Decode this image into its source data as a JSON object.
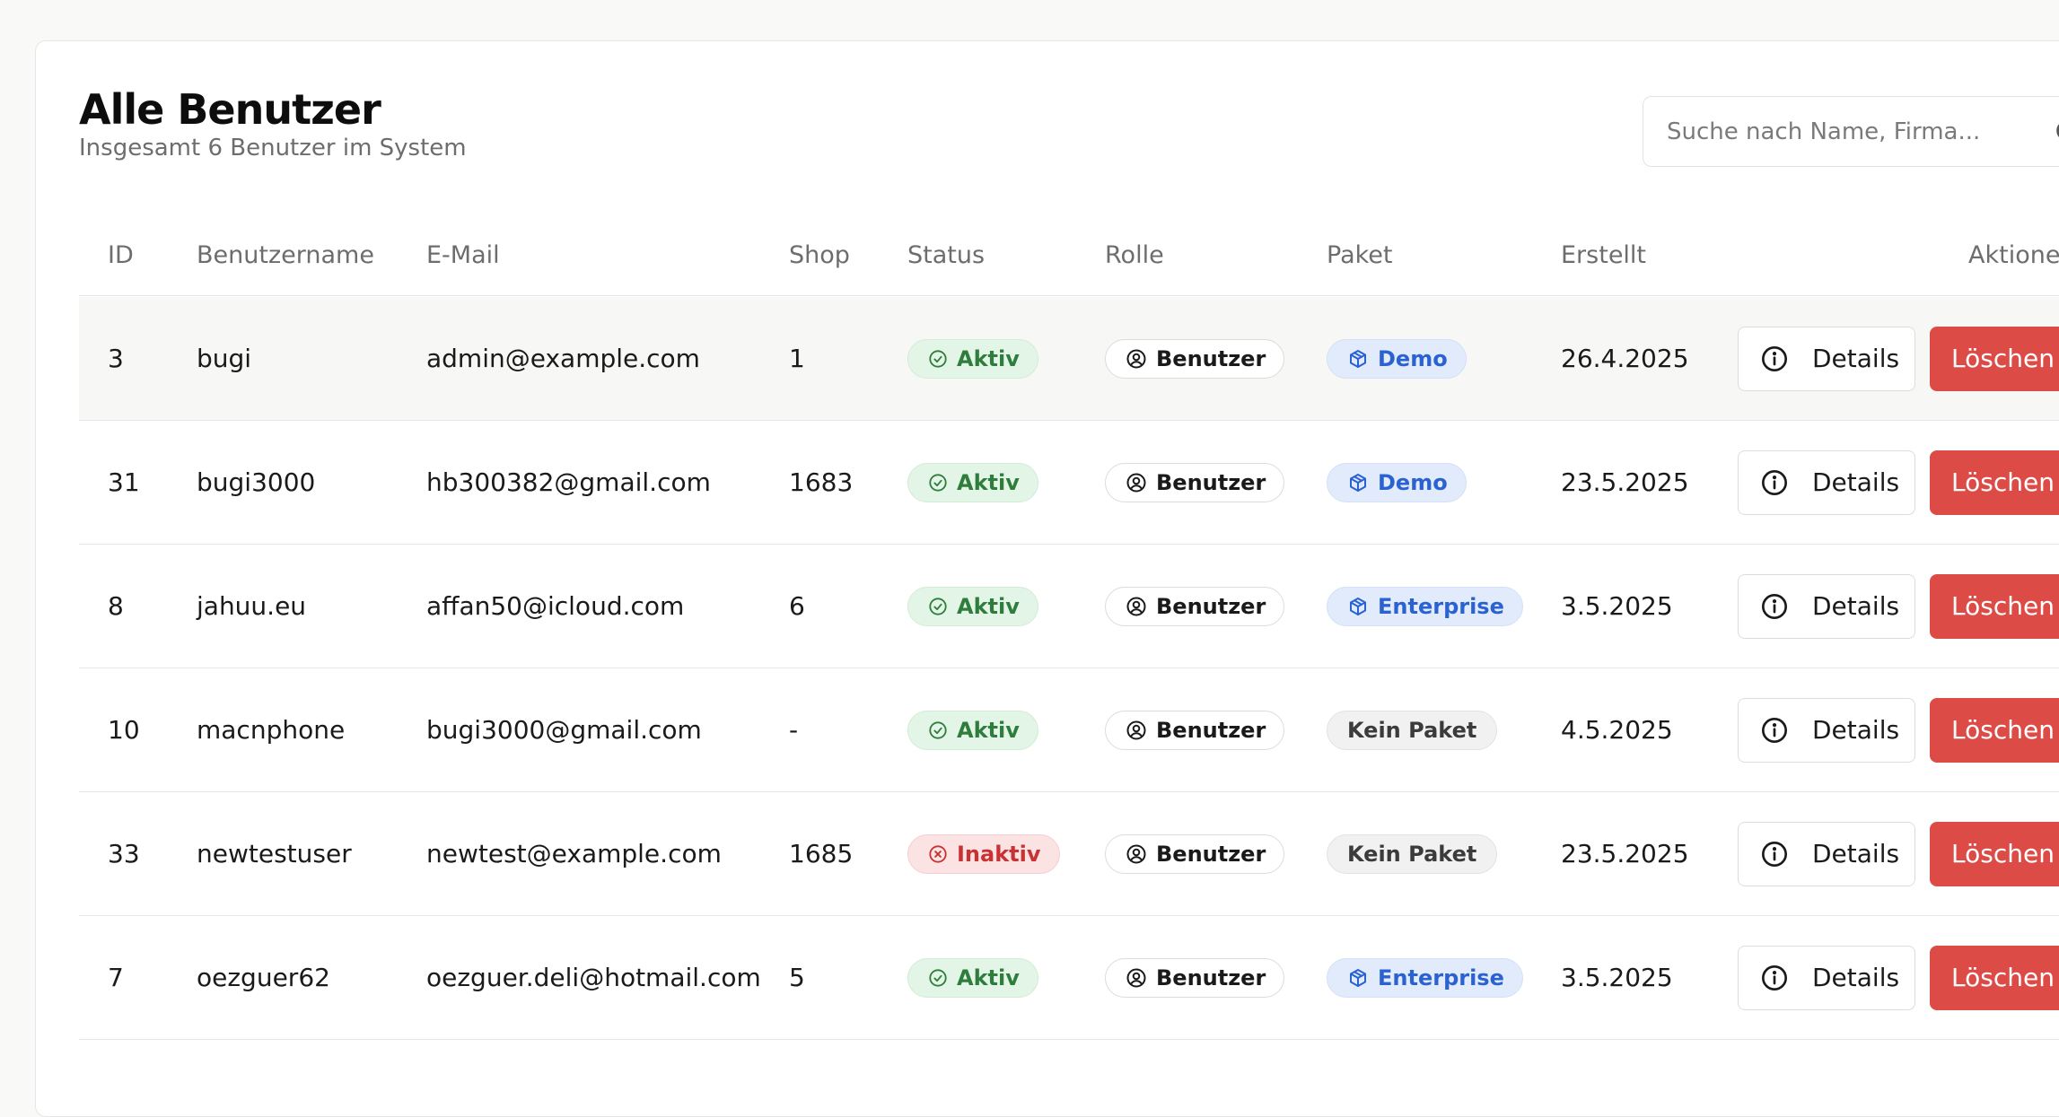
{
  "header": {
    "title": "Alle Benutzer",
    "subtitle": "Insgesamt 6 Benutzer im System"
  },
  "search": {
    "placeholder": "Suche nach Name, Firma..."
  },
  "table": {
    "columns": {
      "id": "ID",
      "username": "Benutzername",
      "email": "E-Mail",
      "shop": "Shop",
      "status": "Status",
      "role": "Rolle",
      "package": "Paket",
      "created": "Erstellt",
      "actions": "Aktionen"
    },
    "rows": [
      {
        "id": "3",
        "username": "bugi",
        "email": "admin@example.com",
        "shop": "1",
        "status": "Aktiv",
        "status_type": "active",
        "role": "Benutzer",
        "package": "Demo",
        "package_type": "plan",
        "created": "26.4.2025",
        "details_label": "Details",
        "delete_label": "Löschen"
      },
      {
        "id": "31",
        "username": "bugi3000",
        "email": "hb300382@gmail.com",
        "shop": "1683",
        "status": "Aktiv",
        "status_type": "active",
        "role": "Benutzer",
        "package": "Demo",
        "package_type": "plan",
        "created": "23.5.2025",
        "details_label": "Details",
        "delete_label": "Löschen"
      },
      {
        "id": "8",
        "username": "jahuu.eu",
        "email": "affan50@icloud.com",
        "shop": "6",
        "status": "Aktiv",
        "status_type": "active",
        "role": "Benutzer",
        "package": "Enterprise",
        "package_type": "plan",
        "created": "3.5.2025",
        "details_label": "Details",
        "delete_label": "Löschen"
      },
      {
        "id": "10",
        "username": "macnphone",
        "email": "bugi3000@gmail.com",
        "shop": "-",
        "status": "Aktiv",
        "status_type": "active",
        "role": "Benutzer",
        "package": "Kein Paket",
        "package_type": "none",
        "created": "4.5.2025",
        "details_label": "Details",
        "delete_label": "Löschen"
      },
      {
        "id": "33",
        "username": "newtestuser",
        "email": "newtest@example.com",
        "shop": "1685",
        "status": "Inaktiv",
        "status_type": "inactive",
        "role": "Benutzer",
        "package": "Kein Paket",
        "package_type": "none",
        "created": "23.5.2025",
        "details_label": "Details",
        "delete_label": "Löschen"
      },
      {
        "id": "7",
        "username": "oezguer62",
        "email": "oezguer.deli@hotmail.com",
        "shop": "5",
        "status": "Aktiv",
        "status_type": "active",
        "role": "Benutzer",
        "package": "Enterprise",
        "package_type": "plan",
        "created": "3.5.2025",
        "details_label": "Details",
        "delete_label": "Löschen"
      }
    ]
  },
  "colors": {
    "delete_button": "#dd4b47",
    "active_badge": "#2f7d3c",
    "inactive_badge": "#c83232",
    "package_badge": "#2b62d1"
  },
  "icons": {
    "status_active": "check-circle-icon",
    "status_inactive": "x-circle-icon",
    "role": "user-circle-icon",
    "package": "box-icon",
    "details": "info-icon",
    "search": "search-icon"
  }
}
